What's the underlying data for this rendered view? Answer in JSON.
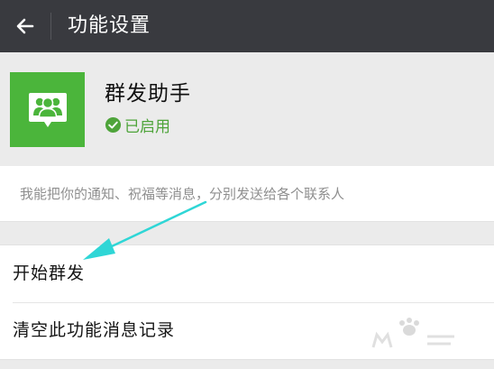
{
  "header": {
    "title": "功能设置",
    "back_icon": "back-arrow-icon"
  },
  "profile": {
    "app_name": "群发助手",
    "status_label": "已启用",
    "logo_icon": "group-chat-icon",
    "status_icon": "check-circle-icon",
    "logo_color": "#4bb53b",
    "status_color": "#4ea43a"
  },
  "description": {
    "text": "我能把你的通知、祝福等消息，分别发送给各个联系人"
  },
  "menu": {
    "items": [
      {
        "label": "开始群发"
      },
      {
        "label": "清空此功能消息记录"
      }
    ]
  },
  "colors": {
    "topbar": "#393a3f",
    "background": "#ebebeb",
    "annotation_arrow": "#2fd6d6"
  }
}
